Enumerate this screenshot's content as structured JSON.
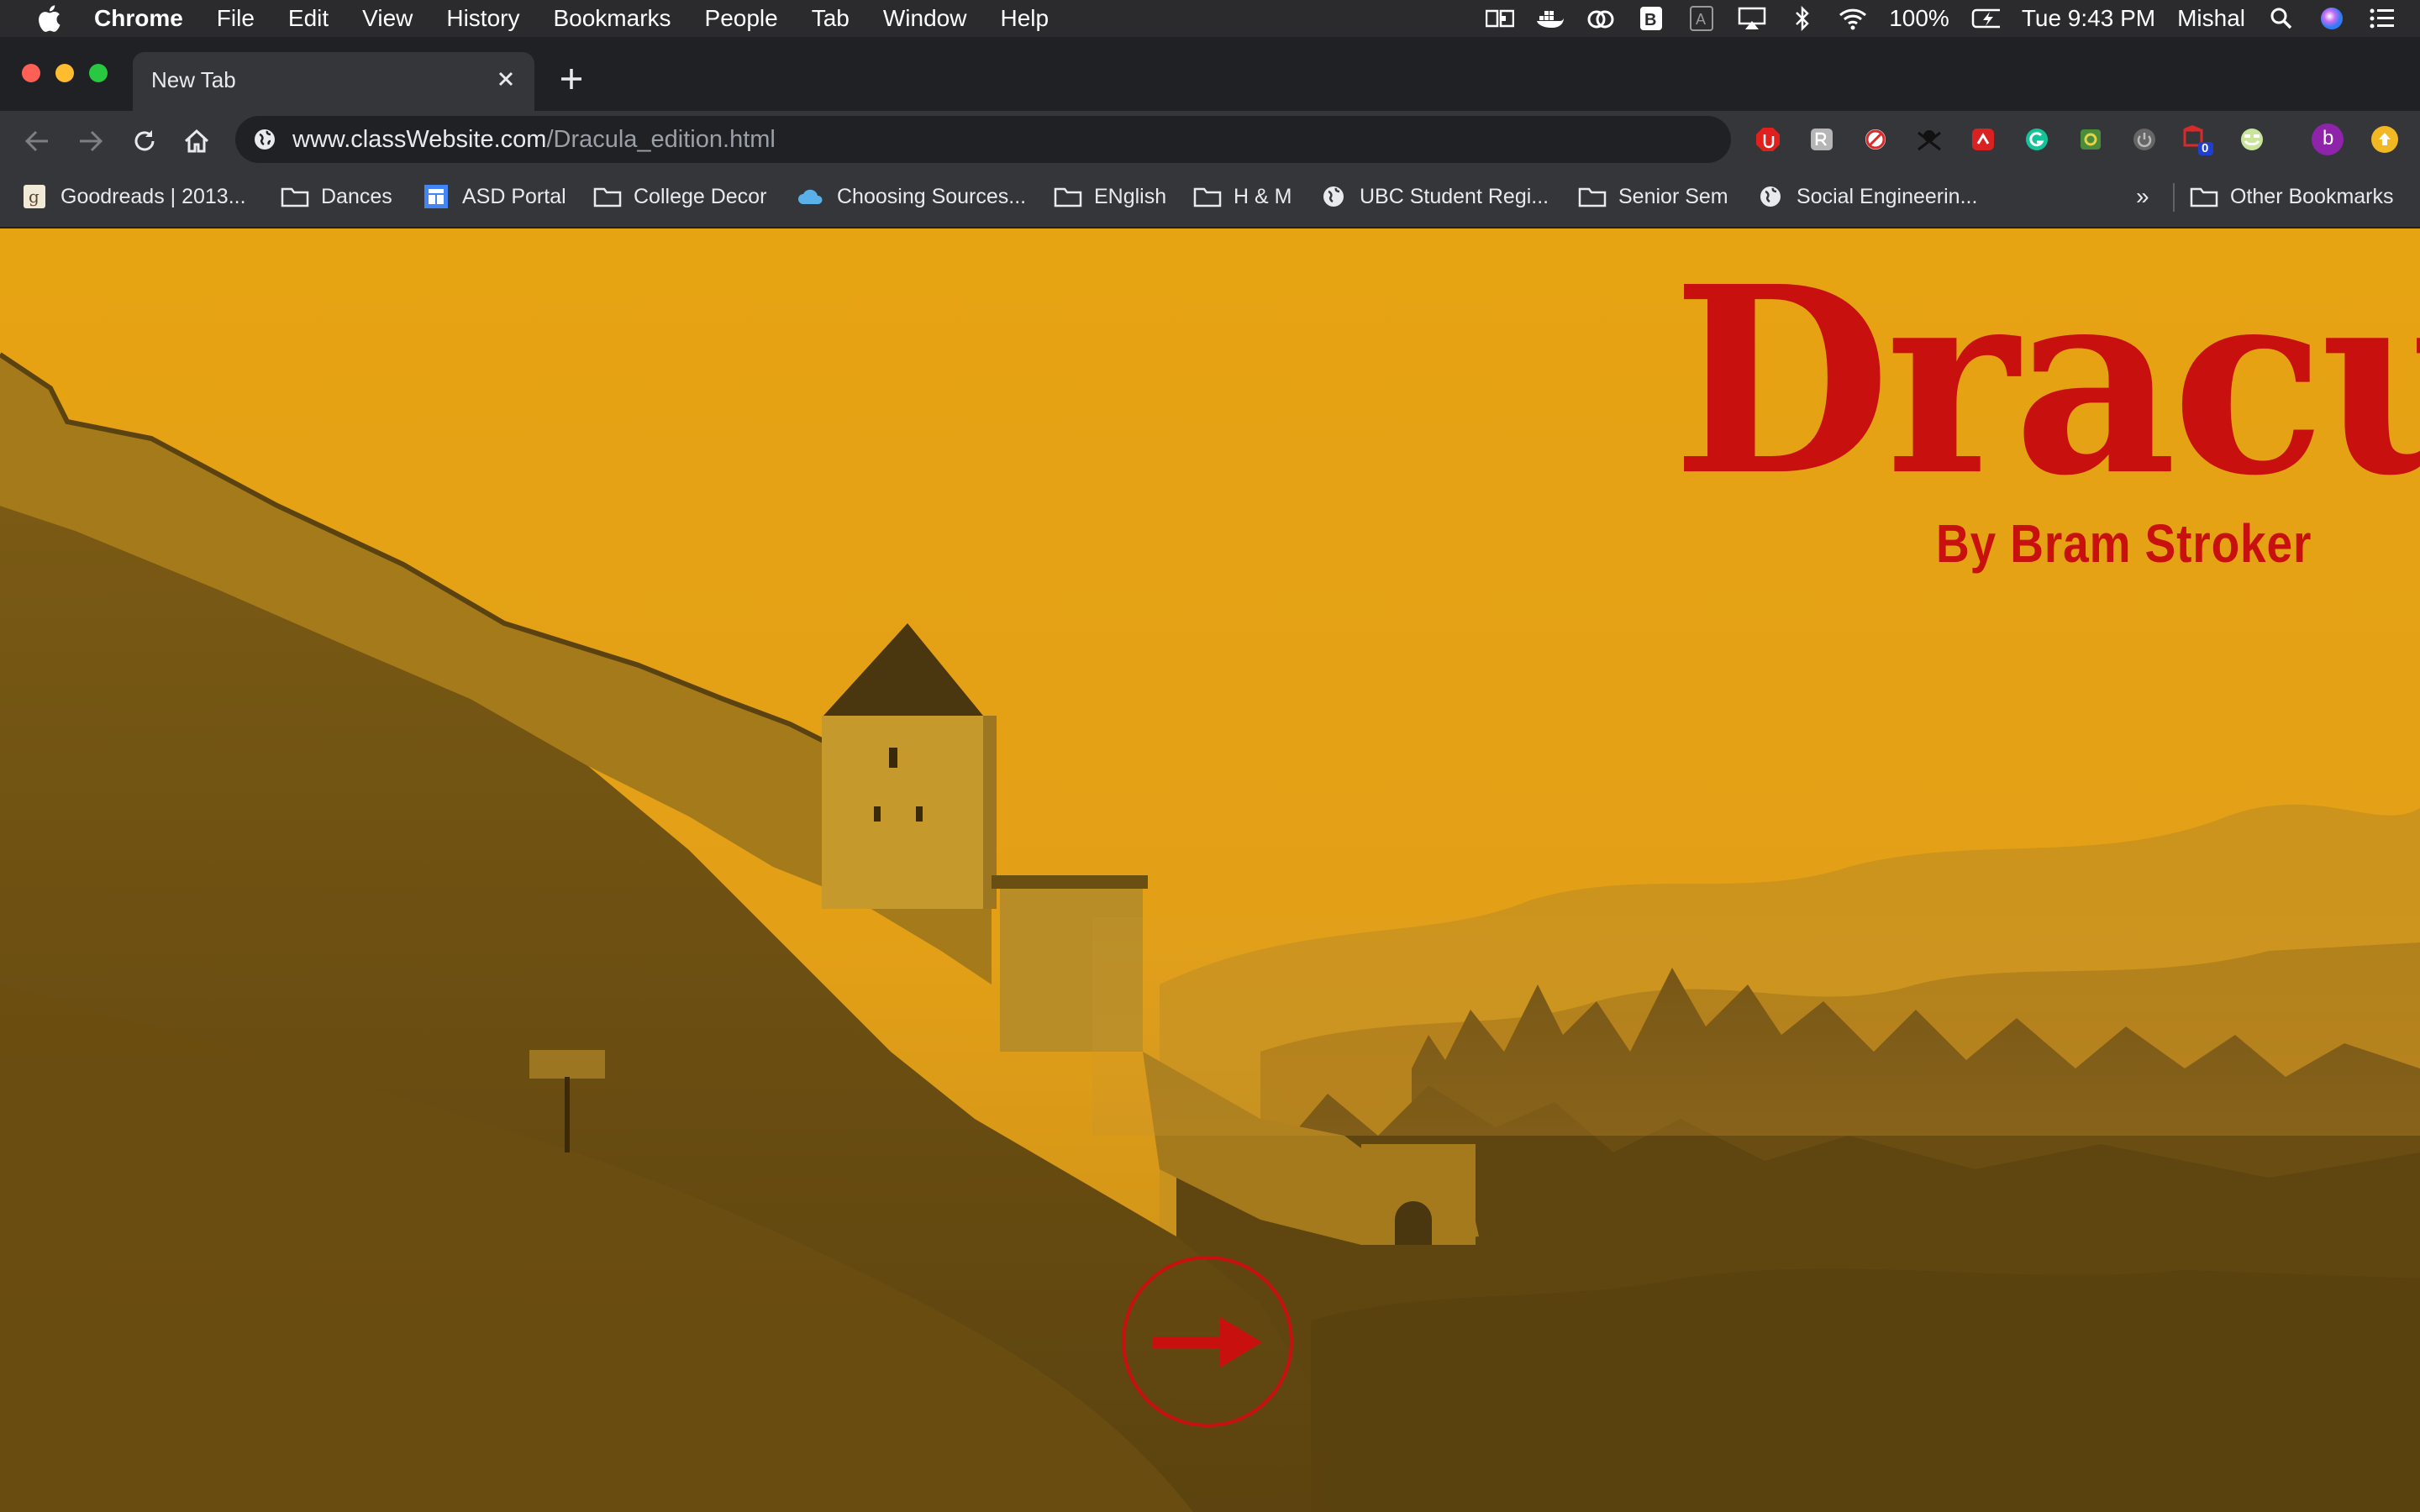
{
  "menubar": {
    "app_name": "Chrome",
    "items": [
      "File",
      "Edit",
      "View",
      "History",
      "Bookmarks",
      "People",
      "Tab",
      "Window",
      "Help"
    ],
    "battery": "100%",
    "clock": "Tue 9:43 PM",
    "user": "Mishal"
  },
  "tab": {
    "title": "New Tab"
  },
  "address_bar": {
    "domain": "www.classWebsite.com",
    "path": "/Dracula_edition.html",
    "extension_badge": "0",
    "profile_initial": "b"
  },
  "bookmarks": {
    "items": [
      {
        "label": "Goodreads | 2013...",
        "icon": "goodreads-icon"
      },
      {
        "label": "Dances",
        "icon": "folder-icon"
      },
      {
        "label": "ASD Portal",
        "icon": "portal-icon"
      },
      {
        "label": "College Decor",
        "icon": "folder-icon"
      },
      {
        "label": "Choosing Sources...",
        "icon": "cloud-icon"
      },
      {
        "label": "ENglish",
        "icon": "folder-icon"
      },
      {
        "label": "H & M",
        "icon": "folder-icon"
      },
      {
        "label": "UBC Student Regi...",
        "icon": "globe-icon"
      },
      {
        "label": "Senior Sem",
        "icon": "folder-icon"
      },
      {
        "label": "Social Engineerin...",
        "icon": "globe-icon"
      }
    ],
    "overflow": "»",
    "other": "Other Bookmarks"
  },
  "hero": {
    "title": "Dracula",
    "subtitle": "By Bram Stroker",
    "next_icon": "arrow-right-circle-icon"
  },
  "colors": {
    "hero_background": "#e4a114",
    "accent_red": "#c8110f",
    "landscape_dark": "#6b4e10"
  }
}
